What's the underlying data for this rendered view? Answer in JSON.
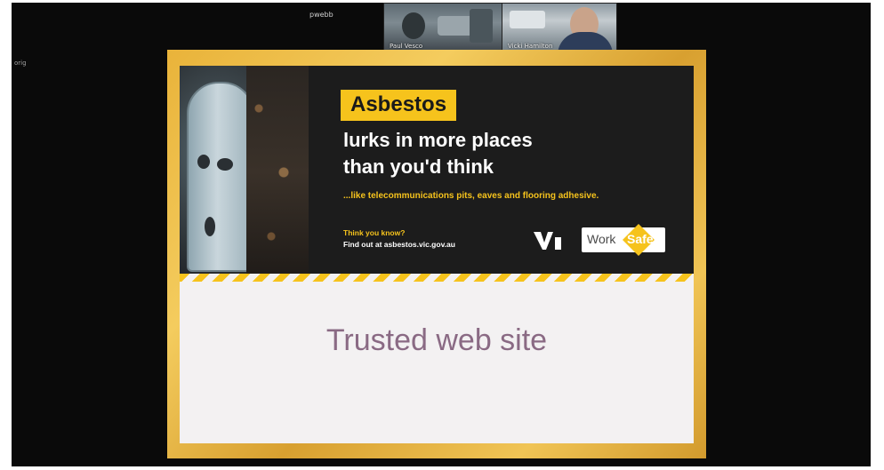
{
  "meeting": {
    "host_label": "pwebb",
    "side_label": "orig",
    "participants": [
      {
        "name": "Paul Vesco"
      },
      {
        "name": "Vicki Hamilton"
      }
    ]
  },
  "slide": {
    "tag": "Asbestos",
    "headline_line1": "lurks in more places",
    "headline_line2": "than you'd think",
    "subline": "...like telecommunications pits, eaves and flooring adhesive.",
    "cta_line1": "Think you know?",
    "cta_line2": "Find out at asbestos.vic.gov.au",
    "logo_work": "Work",
    "logo_safe": "Safe",
    "body_text": "Trusted web site"
  },
  "colors": {
    "accent_yellow": "#f6c31c",
    "frame_gold": "#e9b33a",
    "banner_dark": "#1c1c1c",
    "body_text": "#8a6a84"
  },
  "icons": {
    "vic_gov": "victoria-government-logo",
    "worksafe": "worksafe-logo"
  }
}
